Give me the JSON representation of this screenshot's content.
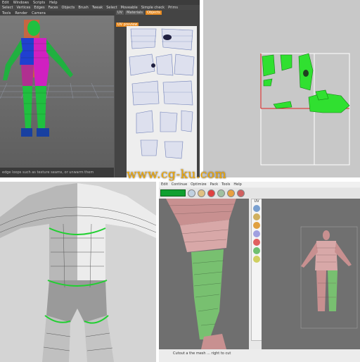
{
  "p1": {
    "menu": [
      "Edit",
      "Windows",
      "Scripts",
      "Help"
    ],
    "toolbar": [
      "Select",
      "Vertices",
      "Edges",
      "Faces",
      "Objects",
      "Brush",
      "Tweak",
      "Select",
      "Moveable",
      "Simple check",
      "Prims"
    ],
    "toolbar2": [
      "Tools",
      "Render",
      "Camera"
    ],
    "uv_tabs": [
      "UV",
      "Materials",
      "Objects"
    ],
    "uv_sub_tab": "UV preview",
    "status": "edge loops such as texture seams, or unwarm them",
    "colors": {
      "accent": "#e88a20",
      "uv_lines": "#8090c0"
    }
  },
  "watermark": "www.cg-ku.com",
  "p4": {
    "menu": [
      "Edit",
      "Continue",
      "Optimize",
      "Pack",
      "Tools",
      "Help"
    ],
    "view_label": "UV",
    "status": "Cutout a the mesh ... right to cut",
    "icons": [
      "select-icon",
      "move-icon",
      "cut-icon",
      "weld-icon",
      "unfold-icon",
      "pack-icon"
    ],
    "colors": {
      "green": "#10a030"
    }
  },
  "p3_icons": [
    "mesh-icon"
  ],
  "colors": {
    "brand": "#f2a800"
  }
}
